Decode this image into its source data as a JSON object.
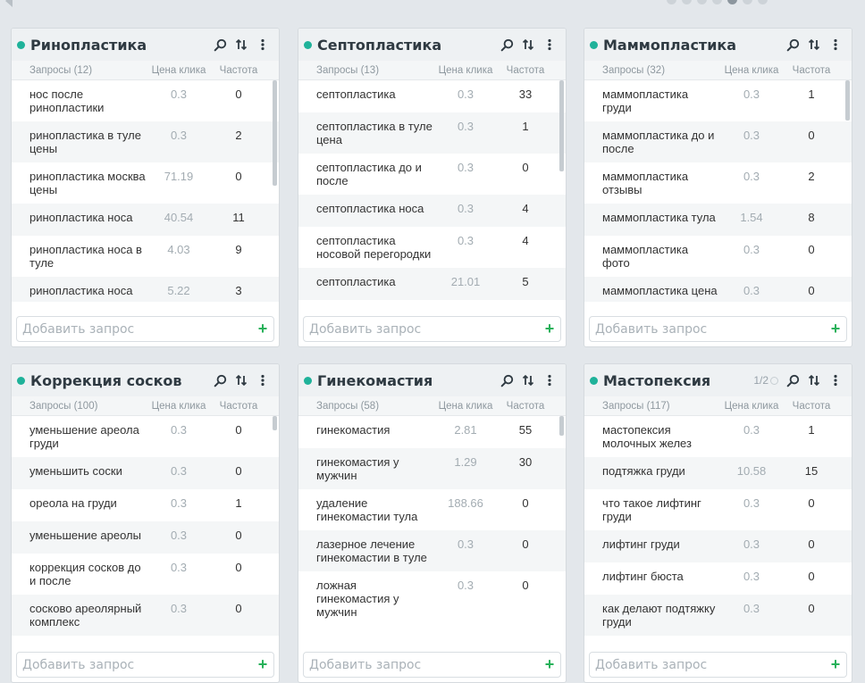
{
  "colors": {
    "accent": "#1fb29a",
    "plus": "#27b15a"
  },
  "pager": {
    "count": 7,
    "active_index": 4
  },
  "cards": [
    {
      "title": "Ринопластика",
      "headers": {
        "q": "Запросы (12)",
        "p": "Цена клика",
        "f": "Частота"
      },
      "rows": [
        {
          "q": "нос после ринопластики",
          "p": "0.3",
          "f": "0"
        },
        {
          "q": "ринопластика в туле цены",
          "p": "0.3",
          "f": "2"
        },
        {
          "q": "ринопластика москва цены",
          "p": "71.19",
          "f": "0"
        },
        {
          "q": "ринопластика носа",
          "p": "40.54",
          "f": "11"
        },
        {
          "q": "ринопластика носа в туле",
          "p": "4.03",
          "f": "9"
        },
        {
          "q": "ринопластика носа",
          "p": "5.22",
          "f": "3"
        }
      ],
      "add_placeholder": "Добавить запрос"
    },
    {
      "title": "Септопластика",
      "headers": {
        "q": "Запросы (13)",
        "p": "Цена клика",
        "f": "Частота"
      },
      "rows": [
        {
          "q": "септопластика",
          "p": "0.3",
          "f": "33"
        },
        {
          "q": "септопластика в туле цена",
          "p": "0.3",
          "f": "1"
        },
        {
          "q": "септопластика до и после",
          "p": "0.3",
          "f": "0"
        },
        {
          "q": "септопластика носа",
          "p": "0.3",
          "f": "4"
        },
        {
          "q": "септопластика носовой перегородки",
          "p": "0.3",
          "f": "4"
        },
        {
          "q": "септопластика",
          "p": "21.01",
          "f": "5"
        }
      ],
      "add_placeholder": "Добавить запрос"
    },
    {
      "title": "Маммопластика",
      "headers": {
        "q": "Запросы (32)",
        "p": "Цена клика",
        "f": "Частота"
      },
      "rows": [
        {
          "q": "маммопластика груди",
          "p": "0.3",
          "f": "1"
        },
        {
          "q": "маммопластика до и после",
          "p": "0.3",
          "f": "0"
        },
        {
          "q": "маммопластика отзывы",
          "p": "0.3",
          "f": "2"
        },
        {
          "q": "маммопластика тула",
          "p": "1.54",
          "f": "8"
        },
        {
          "q": "маммопластика фото",
          "p": "0.3",
          "f": "0"
        },
        {
          "q": "маммопластика цена",
          "p": "0.3",
          "f": "0"
        }
      ],
      "add_placeholder": "Добавить запрос"
    },
    {
      "title": "Коррекция сосков",
      "headers": {
        "q": "Запросы (100)",
        "p": "Цена клика",
        "f": "Частота"
      },
      "rows": [
        {
          "q": "уменьшение ареола груди",
          "p": "0.3",
          "f": "0"
        },
        {
          "q": "уменьшить соски",
          "p": "0.3",
          "f": "0"
        },
        {
          "q": "ореола на груди",
          "p": "0.3",
          "f": "1"
        },
        {
          "q": "уменьшение ареолы",
          "p": "0.3",
          "f": "0"
        },
        {
          "q": "коррекция сосков до и после",
          "p": "0.3",
          "f": "0"
        },
        {
          "q": "сосково ареолярный комплекс",
          "p": "0.3",
          "f": "0"
        }
      ],
      "add_placeholder": "Добавить запрос"
    },
    {
      "title": "Гинекомастия",
      "headers": {
        "q": "Запросы (58)",
        "p": "Цена клика",
        "f": "Частота"
      },
      "rows": [
        {
          "q": "гинекомастия",
          "p": "2.81",
          "f": "55"
        },
        {
          "q": "гинекомастия у мужчин",
          "p": "1.29",
          "f": "30"
        },
        {
          "q": "удаление гинекомастии тула",
          "p": "188.66",
          "f": "0"
        },
        {
          "q": "лазерное лечение гинекомастии в туле",
          "p": "0.3",
          "f": "0"
        },
        {
          "q": "ложная гинекомастия у мужчин",
          "p": "0.3",
          "f": "0"
        }
      ],
      "add_placeholder": "Добавить запрос"
    },
    {
      "title": "Мастопексия",
      "pager": "1/2",
      "headers": {
        "q": "Запросы (117)",
        "p": "Цена клика",
        "f": "Частота"
      },
      "rows": [
        {
          "q": "мастопексия молочных желез",
          "p": "0.3",
          "f": "1"
        },
        {
          "q": "подтяжка груди",
          "p": "10.58",
          "f": "15"
        },
        {
          "q": "что такое лифтинг груди",
          "p": "0.3",
          "f": "0"
        },
        {
          "q": "лифтинг груди",
          "p": "0.3",
          "f": "0"
        },
        {
          "q": "лифтинг бюста",
          "p": "0.3",
          "f": "0"
        },
        {
          "q": "как делают подтяжку груди",
          "p": "0.3",
          "f": "0"
        }
      ],
      "add_placeholder": "Добавить запрос"
    }
  ]
}
